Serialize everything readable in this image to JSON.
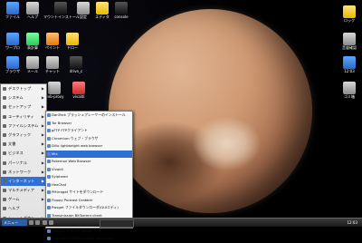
{
  "desktop": {
    "top_icons": [
      {
        "label": "ファイル",
        "icon": "folder-icon"
      },
      {
        "label": "ヘルプ",
        "icon": "help-icon"
      },
      {
        "label": "マウントインストール",
        "icon": "mount-install-icon"
      },
      {
        "label": "設定",
        "icon": "settings-icon"
      },
      {
        "label": "エディタ",
        "icon": "editor-icon"
      },
      {
        "label": "console",
        "icon": "console-icon"
      }
    ],
    "second_row_icons": [
      {
        "label": "ワープロ",
        "icon": "word-processor-icon"
      },
      {
        "label": "表計算",
        "icon": "spreadsheet-icon"
      },
      {
        "label": "ペイント",
        "icon": "paint-icon"
      },
      {
        "label": "ドロー",
        "icon": "draw-icon"
      }
    ],
    "third_row_icons": [
      {
        "label": "ブラウザ",
        "icon": "browser-icon"
      },
      {
        "label": "メール",
        "icon": "mail-icon"
      },
      {
        "label": "チャット",
        "icon": "chat-icon"
      },
      {
        "label": "drive_c",
        "icon": "drive-icon"
      }
    ],
    "middle_labels": [
      {
        "label": "web-proxy",
        "icon": "web-proxy-icon"
      },
      {
        "label": "vivaldi",
        "icon": "vivaldi-icon"
      }
    ],
    "right_icons": [
      {
        "label": "ロック",
        "icon": "lock-icon"
      },
      {
        "label": "音量確認",
        "icon": "volume-icon"
      },
      {
        "label": "12:03",
        "icon": "clock-icon"
      },
      {
        "label": "ゴミ箱",
        "icon": "trash-icon"
      }
    ]
  },
  "start_menu": {
    "items": [
      {
        "label": "デスクトップ",
        "active": false
      },
      {
        "label": "システム",
        "active": false
      },
      {
        "label": "セットアップ",
        "active": false
      },
      {
        "label": "ユーティリティ",
        "active": false
      },
      {
        "label": "ファイルシステム",
        "active": false
      },
      {
        "label": "グラフィック",
        "active": false
      },
      {
        "label": "文書",
        "active": false
      },
      {
        "label": "ビジネス",
        "active": false
      },
      {
        "label": "パーソナル",
        "active": false
      },
      {
        "label": "ネットワーク",
        "active": false
      },
      {
        "label": "インターネット",
        "active": true
      },
      {
        "label": "マルチメディア",
        "active": false
      },
      {
        "label": "ゲーム",
        "active": false
      },
      {
        "label": "ヘルプ",
        "active": false
      },
      {
        "label": "シャットダウン",
        "active": false
      }
    ]
  },
  "internet_submenu": {
    "items": [
      {
        "label": "DanTeck ブラッシュプレーヤーのインストール",
        "active": false
      },
      {
        "label": "Tor Browser",
        "active": false
      },
      {
        "label": "gFTP FTPクライアント",
        "active": false
      },
      {
        "label": "Chromium ウェブ・ブラウザ",
        "active": false
      },
      {
        "label": "Dillo lightweight web browser",
        "active": false
      },
      {
        "label": "Mix",
        "active": true
      },
      {
        "label": "Pokemon Web Browser",
        "active": false
      },
      {
        "label": "Vivaldi",
        "active": false
      },
      {
        "label": "Sylpheed",
        "active": false
      },
      {
        "label": "HexChat",
        "active": false
      },
      {
        "label": "PMirroget サイトをダウンロード",
        "active": false
      },
      {
        "label": "Floppy Podcast Grabber",
        "active": false
      },
      {
        "label": "Pwsget ファイルダウンローダ(GUIエディ)",
        "active": false
      },
      {
        "label": "Transmission BitTorrent client",
        "active": false
      },
      {
        "label": "uGet",
        "active": false
      },
      {
        "label": "Sakugui セキュア tslweb",
        "active": false
      },
      {
        "label": "Pup-Advert-Blocker block online ads",
        "active": false
      }
    ]
  },
  "taskbar": {
    "menu_label": "メニュー",
    "task_label": "",
    "clock": "12:03"
  }
}
